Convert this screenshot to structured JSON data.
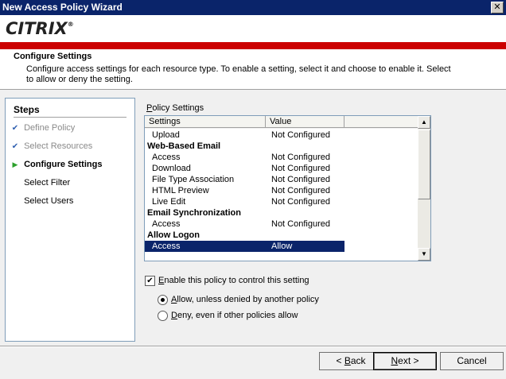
{
  "window": {
    "title": "New Access Policy Wizard",
    "close_glyph": "✕"
  },
  "brand": {
    "logo_text": "CITRIX",
    "logo_mark": "®",
    "accent_color": "#cc0000"
  },
  "header": {
    "title": "Configure Settings",
    "description": "Configure access settings for each resource type. To enable a setting, select it and choose to enable it. Select to allow or deny the setting."
  },
  "steps": {
    "title": "Steps",
    "items": [
      {
        "label": "Define Policy",
        "state": "done",
        "mark": "✔"
      },
      {
        "label": "Select Resources",
        "state": "done",
        "mark": "✔"
      },
      {
        "label": "Configure Settings",
        "state": "current",
        "mark": "▶"
      },
      {
        "label": "Select Filter",
        "state": "pending",
        "mark": ""
      },
      {
        "label": "Select Users",
        "state": "pending",
        "mark": ""
      }
    ]
  },
  "policy": {
    "label_prefix": "P",
    "label_rest": "olicy Settings",
    "columns": [
      "Settings",
      "Value"
    ],
    "rows": [
      {
        "type": "item",
        "setting": "Upload",
        "value": "Not Configured"
      },
      {
        "type": "group",
        "setting": "Web-Based Email"
      },
      {
        "type": "item",
        "setting": "Access",
        "value": "Not Configured"
      },
      {
        "type": "item",
        "setting": "Download",
        "value": "Not Configured"
      },
      {
        "type": "item",
        "setting": "File Type Association",
        "value": "Not Configured"
      },
      {
        "type": "item",
        "setting": "HTML Preview",
        "value": "Not Configured"
      },
      {
        "type": "item",
        "setting": "Live Edit",
        "value": "Not Configured"
      },
      {
        "type": "group",
        "setting": "Email Synchronization"
      },
      {
        "type": "item",
        "setting": "Access",
        "value": "Not Configured"
      },
      {
        "type": "group",
        "setting": "Allow Logon"
      },
      {
        "type": "item",
        "setting": "Access",
        "value": "Allow",
        "selected": true
      }
    ],
    "scroll_up_glyph": "▲",
    "scroll_down_glyph": "▼"
  },
  "options": {
    "enable_checkbox": {
      "label_prefix": "E",
      "label_rest": "nable this policy to control this setting",
      "checked": true,
      "check_glyph": "✔"
    },
    "allow_radio": {
      "label_prefix": "A",
      "label_rest": "llow, unless denied by another policy",
      "selected": true
    },
    "deny_radio": {
      "label_prefix": "D",
      "label_rest": "eny, even if other policies allow",
      "selected": false
    }
  },
  "buttons": {
    "back": {
      "label_prefix": "< ",
      "label_key": "B",
      "label_rest": "ack"
    },
    "next": {
      "label_key": "N",
      "label_rest": "ext >"
    },
    "cancel": {
      "label": "Cancel"
    }
  }
}
